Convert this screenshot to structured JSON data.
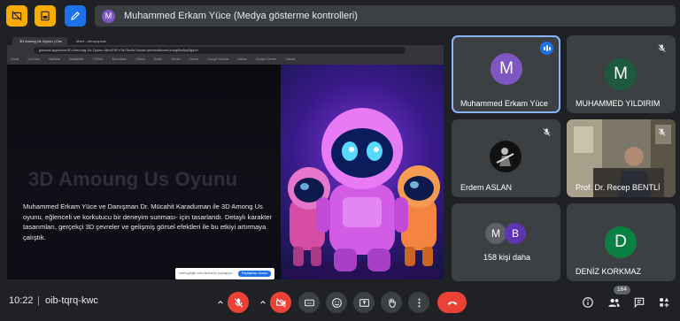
{
  "presenter_bar": {
    "avatar_letter": "M",
    "text": "Muhammed Erkam Yüce (Medya gösterme kontrolleri)"
  },
  "shared_screen": {
    "tabs": [
      "3D Among Us Oyunu | Cnv",
      "Meet - oib-tqrq-kwc"
    ],
    "url": "gamma.app/docs/3D-Amoung-Us-Oyunu-4bnxFhFoTaJTsx9s?mode=present#card-kndq6bzfwy5g4un",
    "bookmarks": [
      "Gmail",
      "YouTube",
      "Haritalar",
      "İstatistikler",
      "YÖKAK",
      "Nöronların",
      "Orbelo",
      "Grafik",
      "Gemini",
      "Canva",
      "Google Scholar",
      "Nature",
      "Google Gemini",
      "Claude"
    ],
    "slide_title": "3D Amoung Us Oyunu",
    "slide_body": "Muhammed Erkam Yüce ve Danışman Dr. Mücahit Karaduman ile 3D Among Us oyunu, eğlenceli ve korkutucu bir deneyim sunması- için tasarlandı. Detaylı karakter tasarımları, gerçekçi 3D çevreler ve gelişmiş görsel efektleri ile bu etkiyi artırmaya çalıştık.",
    "notice_text": "meet.google.com ekranınızı paylaşıyor.",
    "notice_button": "Paylaşmayı durdur"
  },
  "tiles": [
    {
      "name": "Muhammed Erkam Yüce",
      "letter": "M",
      "color": "#7e57c2"
    },
    {
      "name": "MUHAMMED YILDIRIM",
      "letter": "M",
      "color": "#1e5a3e"
    },
    {
      "name": "Erdem ASLAN"
    },
    {
      "name": "Prof. Dr. Recep BENTLİ"
    },
    {
      "name": "158 kişi daha",
      "letters": [
        "M",
        "B"
      ]
    },
    {
      "name": "DENİZ KORKMAZ",
      "letter": "D",
      "color": "#0b8043"
    }
  ],
  "bottom": {
    "time": "10:22",
    "separator": "|",
    "meeting_code": "oib-tqrq-kwc",
    "participants_count": "164"
  },
  "colors": {
    "accent": "#1a73e8",
    "end_call": "#ea4335",
    "surface": "#3c4043",
    "background": "#202124"
  }
}
